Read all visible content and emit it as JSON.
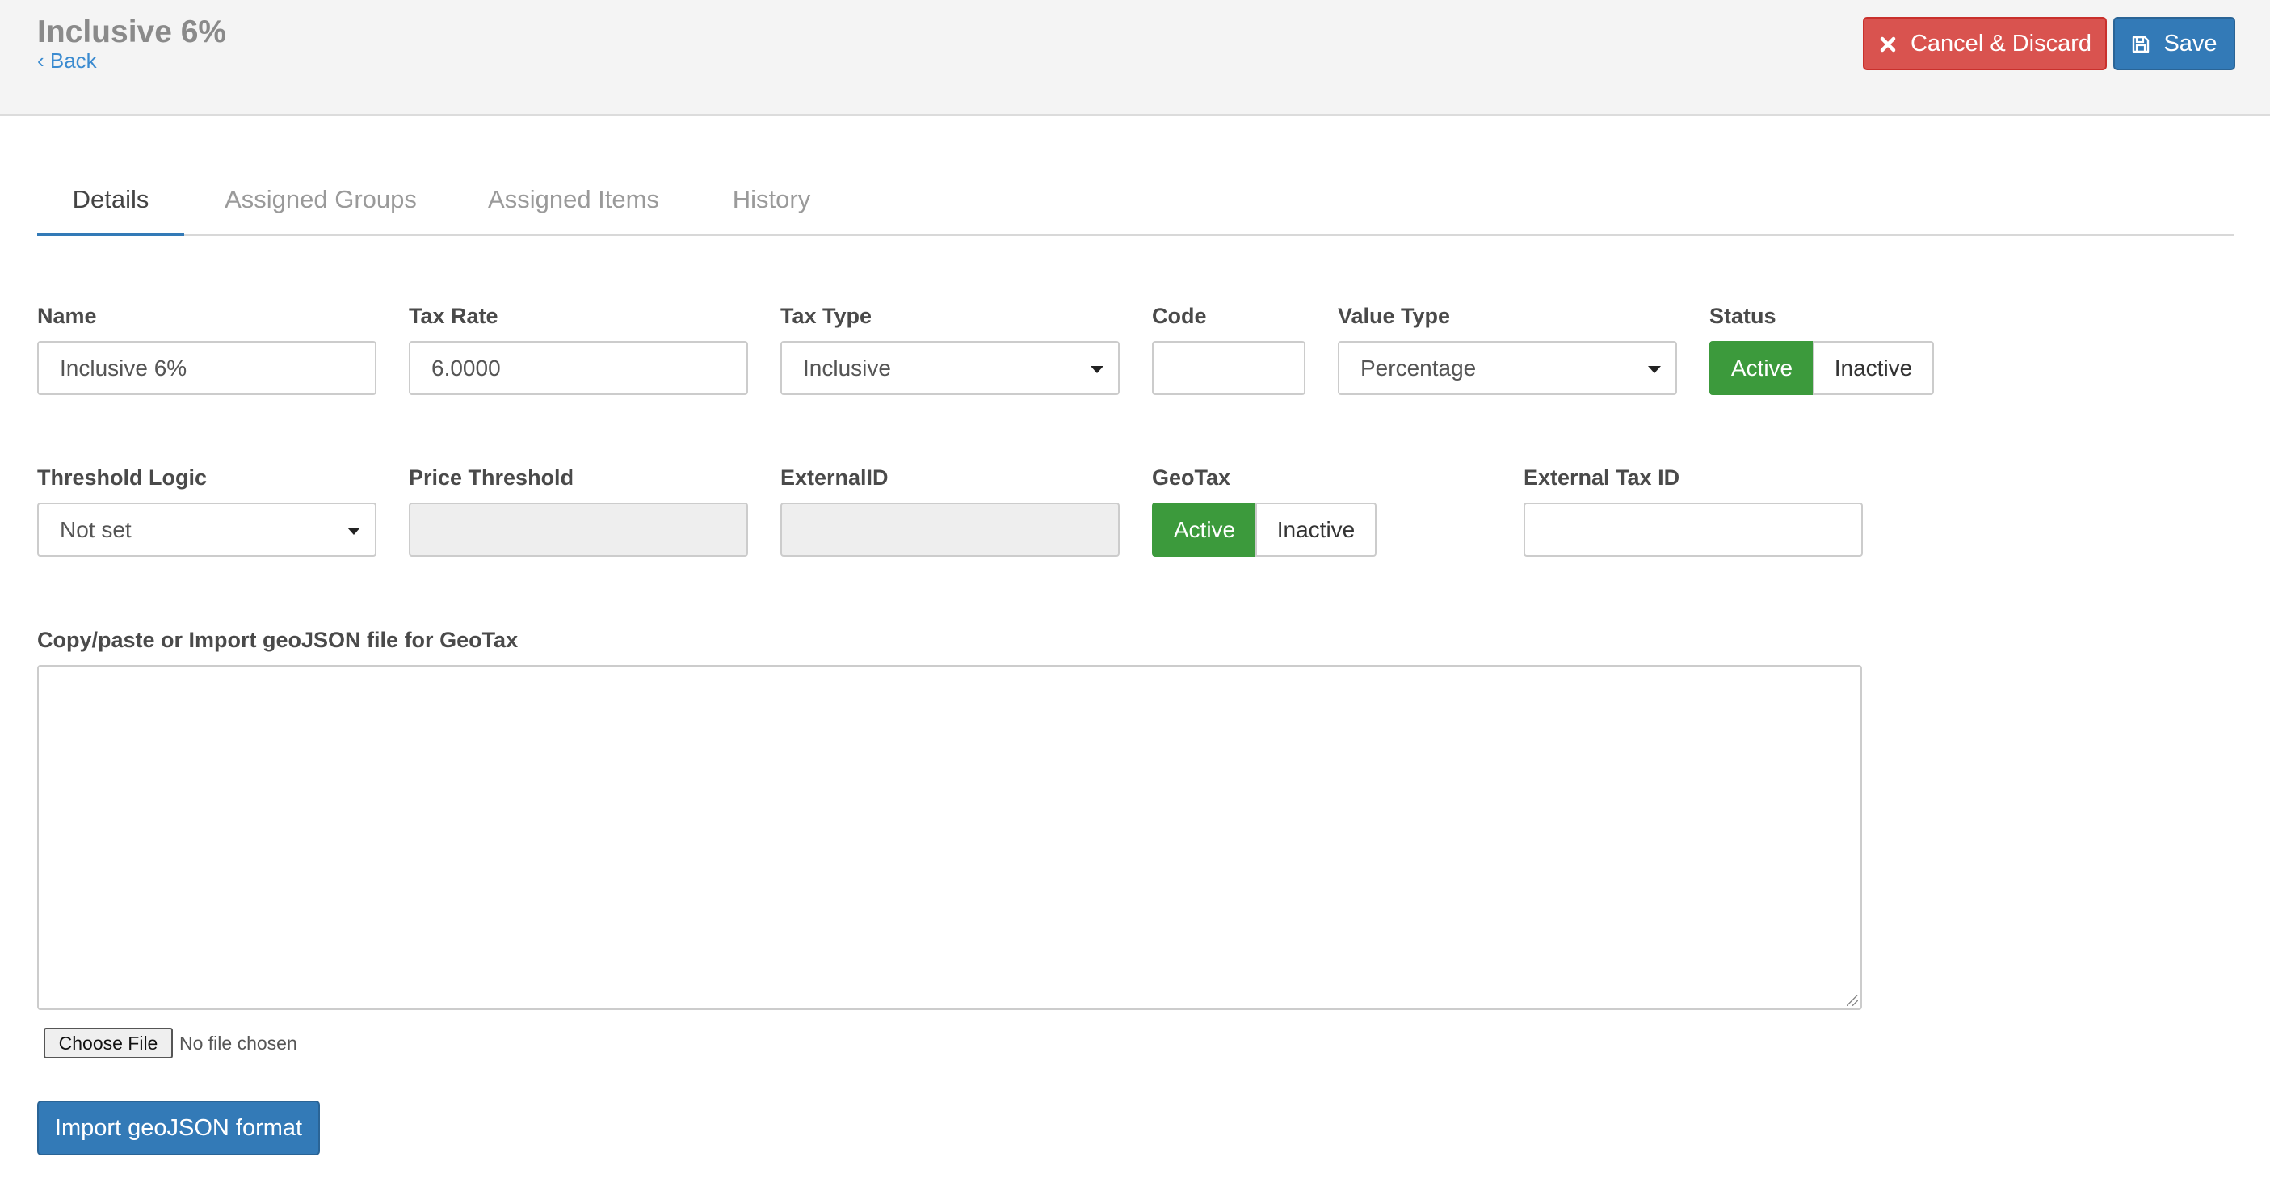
{
  "header": {
    "title": "Inclusive 6%",
    "back_label": "‹ Back",
    "cancel_label": "Cancel & Discard",
    "save_label": "Save"
  },
  "tabs": [
    {
      "label": "Details",
      "active": true
    },
    {
      "label": "Assigned Groups",
      "active": false
    },
    {
      "label": "Assigned Items",
      "active": false
    },
    {
      "label": "History",
      "active": false
    }
  ],
  "form": {
    "name": {
      "label": "Name",
      "value": "Inclusive 6%"
    },
    "tax_rate": {
      "label": "Tax Rate",
      "value": "6.0000"
    },
    "tax_type": {
      "label": "Tax Type",
      "value": "Inclusive"
    },
    "code": {
      "label": "Code",
      "value": ""
    },
    "value_type": {
      "label": "Value Type",
      "value": "Percentage"
    },
    "status": {
      "label": "Status",
      "active_label": "Active",
      "inactive_label": "Inactive",
      "selected": "Active"
    },
    "threshold_logic": {
      "label": "Threshold Logic",
      "value": "Not set"
    },
    "price_threshold": {
      "label": "Price Threshold",
      "value": ""
    },
    "external_id": {
      "label": "ExternalID",
      "value": ""
    },
    "geotax": {
      "label": "GeoTax",
      "active_label": "Active",
      "inactive_label": "Inactive",
      "selected": "Active"
    },
    "external_tax_id": {
      "label": "External Tax ID",
      "value": ""
    },
    "geojson": {
      "label": "Copy/paste or Import geoJSON file for GeoTax",
      "value": ""
    },
    "file": {
      "button_label": "Choose File",
      "status": "No file chosen"
    },
    "import_label": "Import geoJSON format"
  },
  "colors": {
    "primary": "#337ab7",
    "danger": "#d9534f",
    "success": "#3c9a3c"
  },
  "icons": {
    "cancel": "close-icon",
    "save": "floppy-disk-icon",
    "select": "caret-down-icon"
  }
}
